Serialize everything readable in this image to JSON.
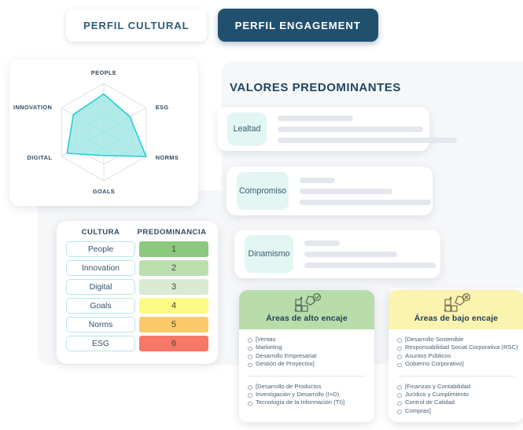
{
  "tabs": [
    {
      "label": "PERFIL CULTURAL",
      "active": false
    },
    {
      "label": "PERFIL ENGAGEMENT",
      "active": true
    }
  ],
  "radar": {
    "axes": [
      "PEOPLE",
      "ESG",
      "NORMS",
      "GOALS",
      "DIGITAL",
      "INNOVATION"
    ],
    "values": [
      0.78,
      0.62,
      1.0,
      0.48,
      0.87,
      0.72
    ],
    "rings": 3,
    "fill_color": "#9ae5e3",
    "stroke_color": "#22cfd6",
    "grid_color": "#dcdfe4"
  },
  "table": {
    "headers": [
      "CULTURA",
      "PREDOMINANCIA"
    ],
    "rows": [
      {
        "cultura": "People",
        "predominancia": "1",
        "color": "#8bc97f"
      },
      {
        "cultura": "Innovation",
        "predominancia": "2",
        "color": "#bcdfb0"
      },
      {
        "cultura": "Digital",
        "predominancia": "3",
        "color": "#d9ead3"
      },
      {
        "cultura": "Goals",
        "predominancia": "4",
        "color": "#fdfa85"
      },
      {
        "cultura": "Norms",
        "predominancia": "5",
        "color": "#fcc96a"
      },
      {
        "cultura": "ESG",
        "predominancia": "6",
        "color": "#f87767"
      }
    ]
  },
  "valores": {
    "title": "VALORES PREDOMINANTES",
    "cards": [
      {
        "label": "Lealtad",
        "bars": [
          96,
          220,
          265
        ]
      },
      {
        "label": "Compromiso",
        "bars": [
          82,
          166,
          210
        ]
      },
      {
        "label": "Dinamismo",
        "bars": [
          82,
          166,
          210
        ]
      }
    ]
  },
  "encaje": {
    "high": {
      "title": "Áreas de alto encaje",
      "icon": "puzzle-check-icon",
      "header_color": "#b9ddaa",
      "group1": [
        "[Ventas",
        "Marketing",
        "Desarrollo Empresarial",
        "Gestión de Proyectos]"
      ],
      "group2": [
        "[Desarrollo de Productos",
        "Investigación y Desarrollo (I+D)",
        "Tecnología de la Información (TI)]"
      ]
    },
    "low": {
      "title": "Áreas de bajo encaje",
      "icon": "puzzle-cross-icon",
      "header_color": "#fbf3b0",
      "group1": [
        "[Desarrollo Sostenible",
        "Responsabilidad Social Corporativa (RSC)",
        "Asuntos Públicos",
        "Gobierno Corporativo]"
      ],
      "group2": [
        "[Finanzas y Contabilidad",
        "Jurídico y Cumplimiento",
        "Control de Calidad",
        "Compras]"
      ]
    }
  },
  "colors": {
    "accent_navy": "#21506e",
    "accent_teal": "#22cfd6",
    "chip_mint": "#e2f6f3",
    "panel_grey": "#f6f7f9"
  }
}
